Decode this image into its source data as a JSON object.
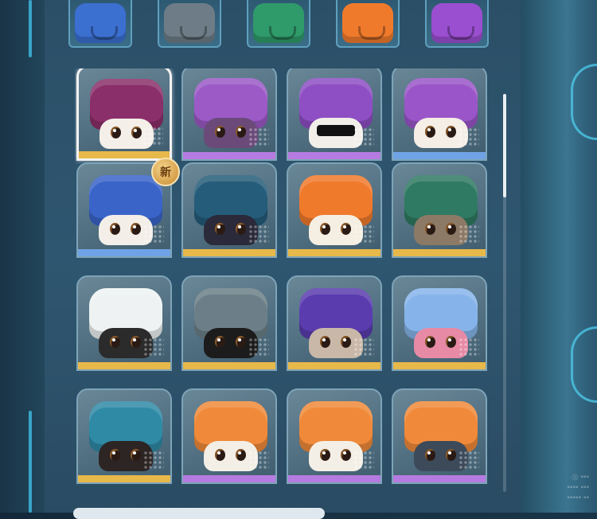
{
  "tabs": [
    {
      "color": "#3b6fd0",
      "icon": "blue-hat-icon"
    },
    {
      "color": "#6d7c86",
      "icon": "gray-hat-icon"
    },
    {
      "color": "#2f9a6a",
      "icon": "green-hat-icon"
    },
    {
      "color": "#f07a2c",
      "icon": "orange-hat-icon"
    },
    {
      "color": "#9a4fd0",
      "icon": "purple-hat-icon"
    }
  ],
  "badge_new": "新",
  "cards": [
    {
      "hat": "#8a2f6a",
      "cat": "#f4efe9",
      "stripe": "#e7b84a",
      "selected": true
    },
    {
      "hat": "#9b5ac6",
      "cat": "#6b4a7a",
      "stripe": "#b67be0"
    },
    {
      "hat": "#8e4fc4",
      "cat": "#f2efe9",
      "stripe": "#b67be0",
      "glasses": true
    },
    {
      "hat": "#9a56c8",
      "cat": "#f4eee6",
      "stripe": "#6fa3e6"
    },
    {
      "hat": "#3a64c8",
      "cat": "#f3efe8",
      "stripe": "#6fa3e6",
      "new": true
    },
    {
      "hat": "#255c7a",
      "cat": "#2a2a3a",
      "stripe": "#e7b84a"
    },
    {
      "hat": "#f07a2c",
      "cat": "#f5eee2",
      "stripe": "#e7b84a"
    },
    {
      "hat": "#2f7a62",
      "cat": "#8c7a66",
      "stripe": "#e7b84a"
    },
    {
      "hat": "#eef2f2",
      "cat": "#2b2b2b",
      "stripe": "#e7b84a"
    },
    {
      "hat": "#6c7f88",
      "cat": "#1c1c1c",
      "stripe": "#e7b84a"
    },
    {
      "hat": "#5a3cae",
      "cat": "#c9b8a8",
      "stripe": "#e7b84a"
    },
    {
      "hat": "#86b4ea",
      "cat": "#e78aa6",
      "stripe": "#e7b84a"
    },
    {
      "hat": "#2f8aa6",
      "cat": "#2d2424",
      "stripe": "#e7b84a"
    },
    {
      "hat": "#f08a3a",
      "cat": "#f4efe6",
      "stripe": "#b67be0"
    },
    {
      "hat": "#f08a3a",
      "cat": "#f4efe6",
      "stripe": "#b67be0"
    },
    {
      "hat": "#f08a3a",
      "cat": "#3c4a5a",
      "stripe": "#b67be0"
    }
  ]
}
